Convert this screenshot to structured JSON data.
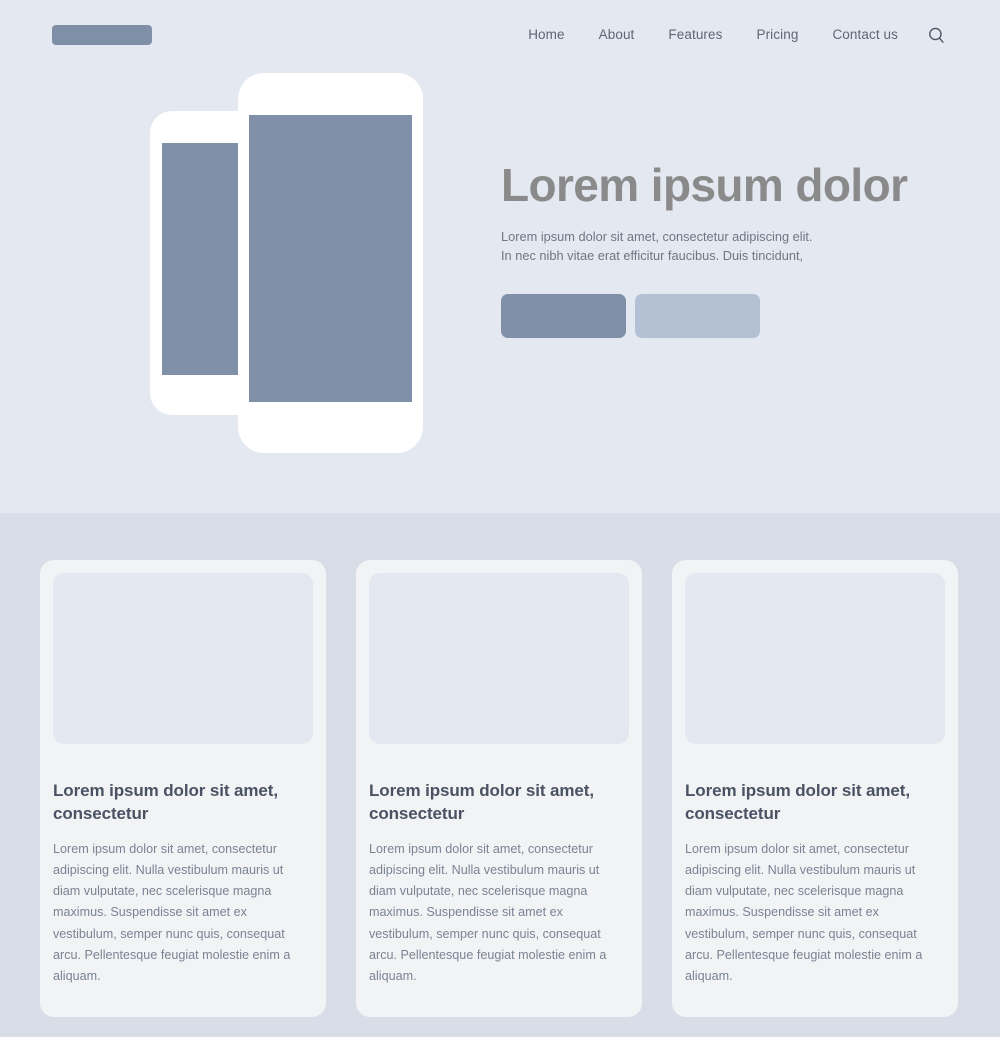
{
  "header": {
    "logo": {
      "name": "brand-logo-placeholder"
    },
    "nav_items": [
      {
        "label": "Home"
      },
      {
        "label": "About"
      },
      {
        "label": "Features"
      },
      {
        "label": "Pricing"
      },
      {
        "label": "Contact us"
      }
    ],
    "search_icon": "search-icon"
  },
  "hero": {
    "title": "Lorem ipsum dolor",
    "subtitle_line1": "Lorem ipsum dolor sit amet, consectetur adipiscing elit.",
    "subtitle_line2": "In nec nibh vitae erat efficitur faucibus. Duis tincidunt,",
    "primary_button_label": "",
    "secondary_button_label": "",
    "mockups": [
      {
        "name": "phone-mockup-back"
      },
      {
        "name": "phone-mockup-front"
      }
    ]
  },
  "cards": [
    {
      "image_placeholder": "card-image-placeholder",
      "title": "Lorem ipsum dolor sit amet, consectetur",
      "body": "Lorem ipsum dolor sit amet, consectetur adipiscing elit. Nulla vestibulum mauris ut diam vulputate, nec scelerisque magna maximus. Suspendisse sit amet ex vestibulum, semper nunc quis, consequat arcu. Pellentesque feugiat molestie enim a aliquam."
    },
    {
      "image_placeholder": "card-image-placeholder",
      "title": "Lorem ipsum dolor sit amet, consectetur",
      "body": "Lorem ipsum dolor sit amet, consectetur adipiscing elit. Nulla vestibulum mauris ut diam vulputate, nec scelerisque magna maximus. Suspendisse sit amet ex vestibulum, semper nunc quis, consequat arcu. Pellentesque feugiat molestie enim a aliquam."
    },
    {
      "image_placeholder": "card-image-placeholder",
      "title": "Lorem ipsum dolor sit amet, consectetur",
      "body": "Lorem ipsum dolor sit amet, consectetur adipiscing elit. Nulla vestibulum mauris ut diam vulputate, nec scelerisque magna maximus. Suspendisse sit amet ex vestibulum, semper nunc quis, consequat arcu. Pellentesque feugiat molestie enim a aliquam."
    }
  ],
  "colors": {
    "hero_background": "#e4e8f0",
    "section_background": "#d9dde8",
    "card_background": "#f2f3f5",
    "accent_slate": "#8090a8",
    "accent_light": "#b4c0d4",
    "heading_gray": "#8a8a8a",
    "card_title": "#4a5263",
    "body_text": "#7a8394",
    "nav_text": "#5d6675"
  }
}
